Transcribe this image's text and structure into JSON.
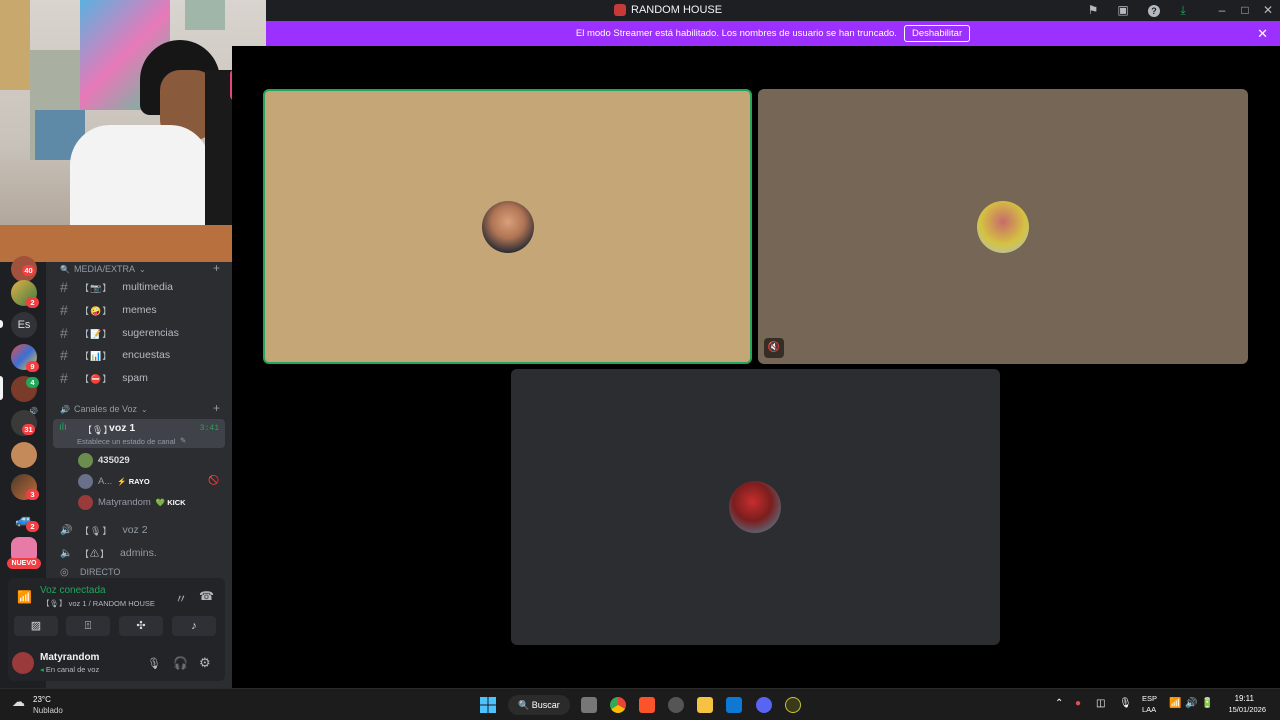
{
  "titlebar": {
    "title": "RANDOM HOUSE",
    "icons": [
      "flag-icon",
      "inbox-icon",
      "help-icon",
      "download-icon",
      "minimize-icon",
      "maximize-icon",
      "close-icon"
    ]
  },
  "banner": {
    "message": "El modo Streamer está habilitado. Los nombres de usuario se han truncado.",
    "button": "Deshabilitar",
    "color": "#9b30ff"
  },
  "servers": {
    "text_server": "Es",
    "badges": [
      "40",
      "2",
      "9",
      "4",
      "31",
      "3",
      "2"
    ],
    "new_label": "NUEVO"
  },
  "channels": {
    "media_category": "MEDIA/EXTRA",
    "text_channels": [
      {
        "emoji": "【📷】",
        "name": "multimedia"
      },
      {
        "emoji": "【🤪】",
        "name": "memes"
      },
      {
        "emoji": "【📝】",
        "name": "sugerencias"
      },
      {
        "emoji": "【📊】",
        "name": "encuestas"
      },
      {
        "emoji": "【⛔】",
        "name": "spam"
      }
    ],
    "voice_category": "Canales de Voz",
    "active_voice": {
      "emoji": "【🎙】",
      "name": "voz 1",
      "timer": "3:41",
      "status_hint": "Establece un estado de canal"
    },
    "voice_users": [
      {
        "name": "435029",
        "tag": ""
      },
      {
        "name": "A...",
        "tag": "⚡ RAYO"
      },
      {
        "name": "Matyrandom",
        "tag": "💚 KICK"
      }
    ],
    "other_voice": [
      {
        "emoji": "【🎙】",
        "name": "voz 2"
      },
      {
        "emoji": "【⚠】",
        "name": "admins."
      },
      {
        "emoji": "",
        "name": "DIRECTO"
      }
    ]
  },
  "voice_panel": {
    "status": "Voz conectada",
    "location": "【🎙】 voz 1 / RANDOM HOUSE",
    "user": "Matyrandom",
    "user_status": "En canal de voz",
    "accent": "#23a55a"
  },
  "taskbar": {
    "weather_temp": "23°C",
    "weather_desc": "Nublado",
    "search_label": "Buscar",
    "lang_top": "ESP",
    "lang_bottom": "LAA",
    "time": "19:11",
    "date": "15/01/2026"
  }
}
